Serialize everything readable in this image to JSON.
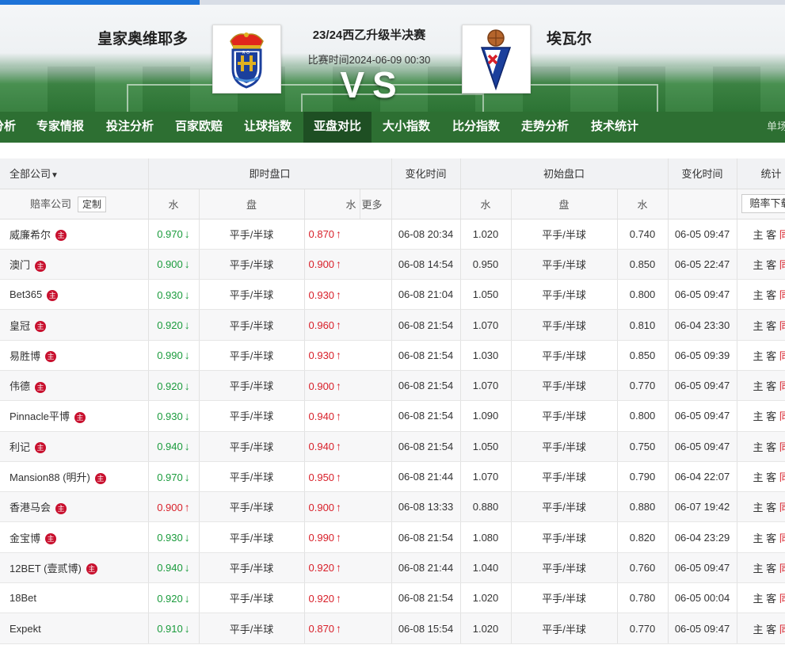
{
  "match": {
    "home_team": "皇家奥维耶多",
    "away_team": "埃瓦尔",
    "league": "23/24西乙升级半决赛",
    "time": "比赛时间2024-06-09 00:30",
    "vs": "VS"
  },
  "nav": {
    "items": [
      "分析",
      "专家情报",
      "投注分析",
      "百家欧赔",
      "让球指数",
      "亚盘对比",
      "大小指数",
      "比分指数",
      "走势分析",
      "技术统计"
    ],
    "active": "亚盘对比",
    "single": "单场"
  },
  "table": {
    "header1": {
      "company_filter": "全部公司",
      "live": "即时盘口",
      "change_time": "变化时间",
      "initial": "初始盘口",
      "change_time2": "变化时间",
      "stats": "统计"
    },
    "header2": {
      "company": "赔率公司",
      "custom": "定制",
      "water": "水",
      "handicap": "盘",
      "water2": "水",
      "more": "更多",
      "i_water": "水",
      "i_handicap": "盘",
      "i_water2": "水",
      "download": "赔率下载"
    },
    "badge": "主",
    "stat_labels": {
      "home": "主",
      "away": "客",
      "same": "同"
    },
    "rows": [
      {
        "company": "威廉希尔",
        "badge": true,
        "home": "0.970",
        "home_dir": "down",
        "line": "平手/半球",
        "away": "0.870",
        "away_dir": "up",
        "time": "06-08 20:34",
        "i_home": "1.020",
        "i_line": "平手/半球",
        "i_away": "0.740",
        "i_time": "06-05 09:47"
      },
      {
        "company": "澳门",
        "badge": true,
        "home": "0.900",
        "home_dir": "down",
        "line": "平手/半球",
        "away": "0.900",
        "away_dir": "up",
        "time": "06-08 14:54",
        "i_home": "0.950",
        "i_line": "平手/半球",
        "i_away": "0.850",
        "i_time": "06-05 22:47"
      },
      {
        "company": "Bet365",
        "badge": true,
        "home": "0.930",
        "home_dir": "down",
        "line": "平手/半球",
        "away": "0.930",
        "away_dir": "up",
        "time": "06-08 21:04",
        "i_home": "1.050",
        "i_line": "平手/半球",
        "i_away": "0.800",
        "i_time": "06-05 09:47"
      },
      {
        "company": "皇冠",
        "badge": true,
        "home": "0.920",
        "home_dir": "down",
        "line": "平手/半球",
        "away": "0.960",
        "away_dir": "up",
        "time": "06-08 21:54",
        "i_home": "1.070",
        "i_line": "平手/半球",
        "i_away": "0.810",
        "i_time": "06-04 23:30"
      },
      {
        "company": "易胜博",
        "badge": true,
        "home": "0.990",
        "home_dir": "down",
        "line": "平手/半球",
        "away": "0.930",
        "away_dir": "up",
        "time": "06-08 21:54",
        "i_home": "1.030",
        "i_line": "平手/半球",
        "i_away": "0.850",
        "i_time": "06-05 09:39"
      },
      {
        "company": "伟德",
        "badge": true,
        "home": "0.920",
        "home_dir": "down",
        "line": "平手/半球",
        "away": "0.900",
        "away_dir": "up",
        "time": "06-08 21:54",
        "i_home": "1.070",
        "i_line": "平手/半球",
        "i_away": "0.770",
        "i_time": "06-05 09:47"
      },
      {
        "company": "Pinnacle平博",
        "badge": true,
        "home": "0.930",
        "home_dir": "down",
        "line": "平手/半球",
        "away": "0.940",
        "away_dir": "up",
        "time": "06-08 21:54",
        "i_home": "1.090",
        "i_line": "平手/半球",
        "i_away": "0.800",
        "i_time": "06-05 09:47"
      },
      {
        "company": "利记",
        "badge": true,
        "home": "0.940",
        "home_dir": "down",
        "line": "平手/半球",
        "away": "0.940",
        "away_dir": "up",
        "time": "06-08 21:54",
        "i_home": "1.050",
        "i_line": "平手/半球",
        "i_away": "0.750",
        "i_time": "06-05 09:47"
      },
      {
        "company": "Mansion88 (明升)",
        "badge": true,
        "home": "0.970",
        "home_dir": "down",
        "line": "平手/半球",
        "away": "0.950",
        "away_dir": "up",
        "time": "06-08 21:44",
        "i_home": "1.070",
        "i_line": "平手/半球",
        "i_away": "0.790",
        "i_time": "06-04 22:07"
      },
      {
        "company": "香港马会",
        "badge": true,
        "home": "0.900",
        "home_dir": "up",
        "line": "平手/半球",
        "away": "0.900",
        "away_dir": "up",
        "time": "06-08 13:33",
        "i_home": "0.880",
        "i_line": "平手/半球",
        "i_away": "0.880",
        "i_time": "06-07 19:42"
      },
      {
        "company": "金宝博",
        "badge": true,
        "home": "0.930",
        "home_dir": "down",
        "line": "平手/半球",
        "away": "0.990",
        "away_dir": "up",
        "time": "06-08 21:54",
        "i_home": "1.080",
        "i_line": "平手/半球",
        "i_away": "0.820",
        "i_time": "06-04 23:29"
      },
      {
        "company": "12BET (壹贰博)",
        "badge": true,
        "home": "0.940",
        "home_dir": "down",
        "line": "平手/半球",
        "away": "0.920",
        "away_dir": "up",
        "time": "06-08 21:44",
        "i_home": "1.040",
        "i_line": "平手/半球",
        "i_away": "0.760",
        "i_time": "06-05 09:47"
      },
      {
        "company": "18Bet",
        "badge": false,
        "home": "0.920",
        "home_dir": "down",
        "line": "平手/半球",
        "away": "0.920",
        "away_dir": "up",
        "time": "06-08 21:54",
        "i_home": "1.020",
        "i_line": "平手/半球",
        "i_away": "0.780",
        "i_time": "06-05 00:04"
      },
      {
        "company": "Expekt",
        "badge": false,
        "home": "0.910",
        "home_dir": "down",
        "line": "平手/半球",
        "away": "0.870",
        "away_dir": "up",
        "time": "06-08 15:54",
        "i_home": "1.020",
        "i_line": "平手/半球",
        "i_away": "0.770",
        "i_time": "06-05 09:47"
      }
    ]
  },
  "colors": {
    "down": "#1a9b3c",
    "up": "#d8202a",
    "nav_bg": "#2d6f32",
    "nav_active": "#1e4f23",
    "accent": "#1e73d8"
  }
}
